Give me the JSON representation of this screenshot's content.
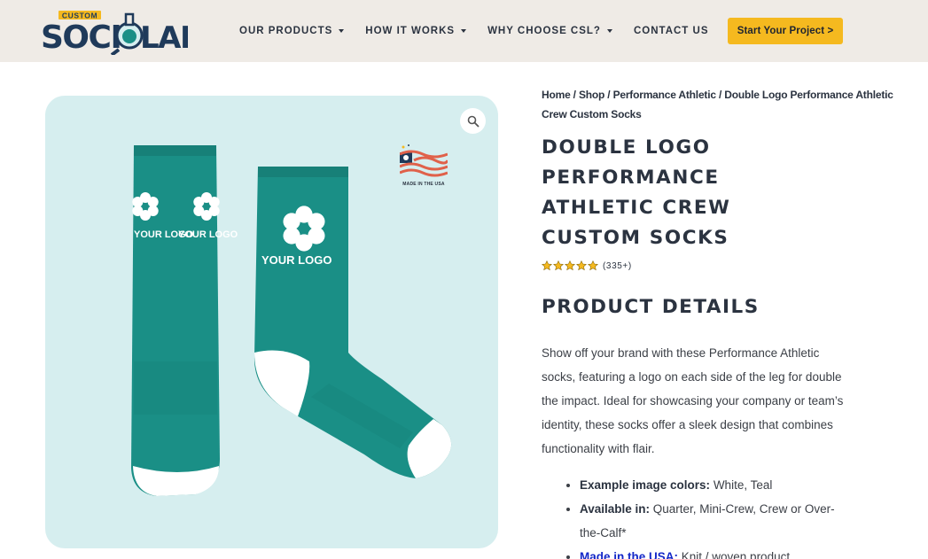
{
  "header": {
    "logo": {
      "top_word": "CUSTOM",
      "left_word": "SOCK",
      "right_word": "LAB",
      "alt": "Custom Sock Lab"
    },
    "nav": [
      {
        "label": "OUR PRODUCTS",
        "has_dropdown": true
      },
      {
        "label": "HOW IT WORKS",
        "has_dropdown": true
      },
      {
        "label": "WHY CHOOSE CSL?",
        "has_dropdown": true
      },
      {
        "label": "CONTACT US",
        "has_dropdown": false
      }
    ],
    "cta_label": "Start Your Project >"
  },
  "gallery": {
    "badge_text": "MADE IN THE USA",
    "sock_logo_text_left": "YOUR LOGO",
    "sock_logo_text_right": "YOUR LOGO",
    "sock_color": "#1a8f86"
  },
  "breadcrumb": {
    "home": "Home",
    "shop": "Shop",
    "category": "Performance Athletic",
    "current": "Double Logo Performance Athletic Crew Custom Socks",
    "separator": " / "
  },
  "product": {
    "title": "DOUBLE LOGO PERFORMANCE ATHLETIC CREW CUSTOM SOCKS",
    "rating_stars": 5,
    "rating_count": "(335+)",
    "details_heading": "PRODUCT DETAILS",
    "description": "Show off your brand with these Performance Athletic socks, featuring a logo on each side of the leg for double the impact. Ideal for showcasing your company or team’s identity, these socks offer a sleek design that combines functionality with flair.",
    "bullets": [
      {
        "label": "Example image colors:",
        "value": " White, Teal"
      },
      {
        "label": "Available in:",
        "value": " Quarter, Mini-Crew, Crew or Over-the-Calf*"
      },
      {
        "label": "Made in the USA:",
        "value": " Knit / woven product"
      }
    ]
  },
  "colors": {
    "header_bg": "#efebe6",
    "cta_bg": "#f5b91f",
    "gallery_bg": "#d6eeef",
    "text_dark": "#2b3340",
    "link_blue": "#1428c8",
    "star": "#f5b91f"
  }
}
